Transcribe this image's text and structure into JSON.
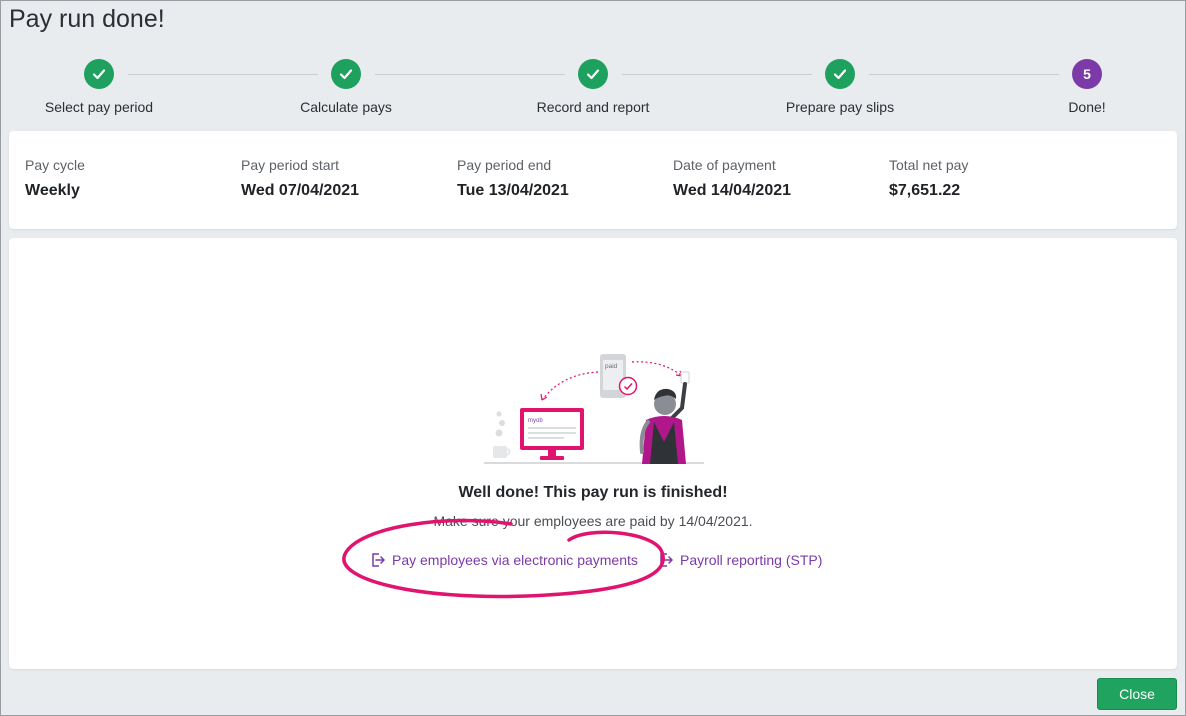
{
  "page": {
    "title": "Pay run done!"
  },
  "stepper": {
    "steps": [
      {
        "label": "Select pay period",
        "status": "done",
        "number": ""
      },
      {
        "label": "Calculate pays",
        "status": "done",
        "number": ""
      },
      {
        "label": "Record and report",
        "status": "done",
        "number": ""
      },
      {
        "label": "Prepare pay slips",
        "status": "done",
        "number": ""
      },
      {
        "label": "Done!",
        "status": "current",
        "number": "5"
      }
    ]
  },
  "summary": {
    "pay_cycle": {
      "label": "Pay cycle",
      "value": "Weekly"
    },
    "period_start": {
      "label": "Pay period start",
      "value": "Wed 07/04/2021"
    },
    "period_end": {
      "label": "Pay period end",
      "value": "Tue 13/04/2021"
    },
    "payment_date": {
      "label": "Date of payment",
      "value": "Wed 14/04/2021"
    },
    "total_net": {
      "label": "Total net pay",
      "value": "$7,651.22"
    }
  },
  "main": {
    "heading": "Well done! This pay run is finished!",
    "subtext": "Make sure your employees are paid by 14/04/2021.",
    "links": {
      "electronic_payments": "Pay employees via electronic payments",
      "payroll_reporting": "Payroll reporting (STP)"
    },
    "illustration": {
      "phone_text": "paid",
      "screen_text": "myob"
    }
  },
  "footer": {
    "close_label": "Close"
  },
  "colors": {
    "accent_purple": "#7c3aa8",
    "success_green": "#1ea05f",
    "annotation_pink": "#e0146e"
  }
}
